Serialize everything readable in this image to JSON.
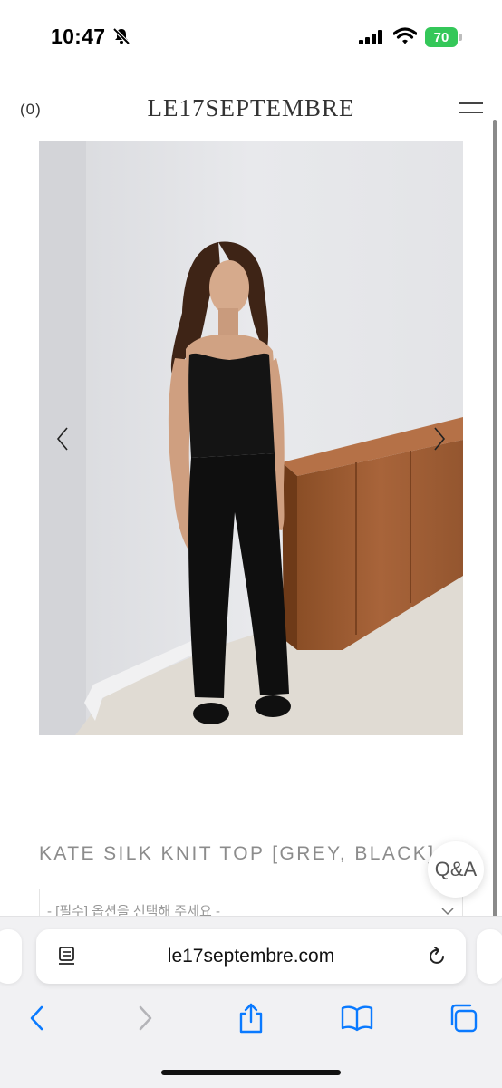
{
  "status_bar": {
    "time": "10:47",
    "battery": "70"
  },
  "header": {
    "cart_count": "(0)",
    "brand": "LE17SEPTEMBRE"
  },
  "product": {
    "name": "KATE SILK KNIT TOP [GREY, BLACK]",
    "option_placeholder": "- [필수] 옵션을 선택해 주세요 -"
  },
  "qa_button": {
    "label": "Q&A"
  },
  "browser": {
    "url": "le17septembre.com"
  },
  "icons": {
    "silent": "bell-slash-icon",
    "signal": "cellular-signal-icon",
    "wifi": "wifi-icon",
    "menu": "hamburger-menu-icon",
    "prev": "chevron-left-icon",
    "next": "chevron-right-icon",
    "reader": "reader-mode-icon",
    "reload": "reload-icon",
    "back": "back-arrow-icon",
    "forward": "forward-arrow-icon",
    "share": "share-icon",
    "bookmarks": "bookmarks-icon",
    "tabs": "tabs-icon"
  },
  "colors": {
    "accent": "#0a7aff",
    "battery": "#34c759",
    "product_name": "#8c8c8c"
  }
}
